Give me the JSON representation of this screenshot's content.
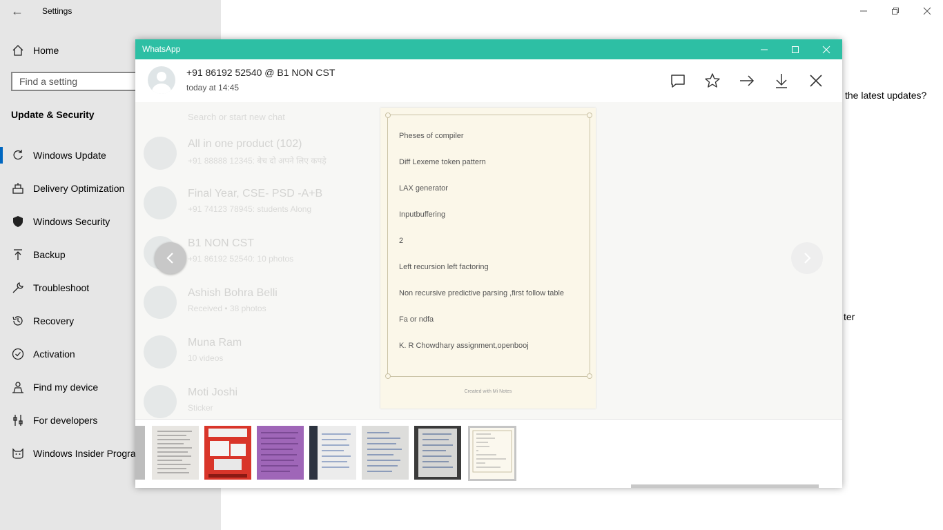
{
  "settings": {
    "title": "Settings",
    "back_icon": "arrow-left-icon",
    "home_label": "Home",
    "search_placeholder": "Find a setting",
    "section_title": "Update & Security",
    "items": [
      {
        "label": "Windows Update",
        "icon": "refresh-icon"
      },
      {
        "label": "Delivery Optimization",
        "icon": "delivery-icon"
      },
      {
        "label": "Windows Security",
        "icon": "shield-icon"
      },
      {
        "label": "Backup",
        "icon": "upload-icon"
      },
      {
        "label": "Troubleshoot",
        "icon": "wrench-icon"
      },
      {
        "label": "Recovery",
        "icon": "history-icon"
      },
      {
        "label": "Activation",
        "icon": "check-circle-icon"
      },
      {
        "label": "Find my device",
        "icon": "person-locate-icon"
      },
      {
        "label": "For developers",
        "icon": "sliders-icon"
      },
      {
        "label": "Windows Insider Progra",
        "icon": "cat-icon"
      }
    ],
    "page_text_1": "the latest updates?",
    "page_text_2": "ter",
    "accent": "#0067c0"
  },
  "whatsapp": {
    "window_title": "WhatsApp",
    "titlebar_color": "#2dbfa4",
    "contact_name": "+91 86192 52540 @ B1 NON CST",
    "timestamp": "today at 14:45",
    "header_actions": [
      "comment-icon",
      "star-icon",
      "forward-icon",
      "download-icon",
      "close-icon"
    ],
    "background_list": {
      "search_text": "Search or start new chat",
      "chats": [
        {
          "name": "All in one product (102)",
          "snippet": "+91 88888 12345: बेच दो अपने लिए कपड़े"
        },
        {
          "name": "Final Year, CSE- PSD -A+B",
          "snippet": "+91 74123 78945: students Along"
        },
        {
          "name": "B1 NON CST",
          "snippet": "+91 86192 52540: 10 photos"
        },
        {
          "name": "Ashish Bohra Belli",
          "snippet": "Received • 38 photos"
        },
        {
          "name": "Muna Ram",
          "snippet": "10 videos"
        },
        {
          "name": "Moti Joshi",
          "snippet": "Sticker"
        }
      ]
    },
    "note": {
      "lines": [
        "Pheses of compiler",
        "Diff Lexeme token pattern",
        "LAX generator",
        "Inputbuffering",
        "2",
        "Left recursion left factoring",
        "Non recursive predictive parsing ,first follow table",
        "Fa or ndfa",
        "K. R Chowdhary assignment,openbooj"
      ],
      "footer": "Created with Mi Notes"
    },
    "prev_icon": "chevron-left-icon",
    "next_icon": "chevron-right-icon",
    "thumbnails": [
      {
        "type": "partial"
      },
      {
        "type": "printed-list"
      },
      {
        "type": "book-cover-red"
      },
      {
        "type": "purple-page"
      },
      {
        "type": "handwritten-blue"
      },
      {
        "type": "notebook-lined"
      },
      {
        "type": "notebook-dark"
      },
      {
        "type": "note-selected"
      }
    ]
  }
}
